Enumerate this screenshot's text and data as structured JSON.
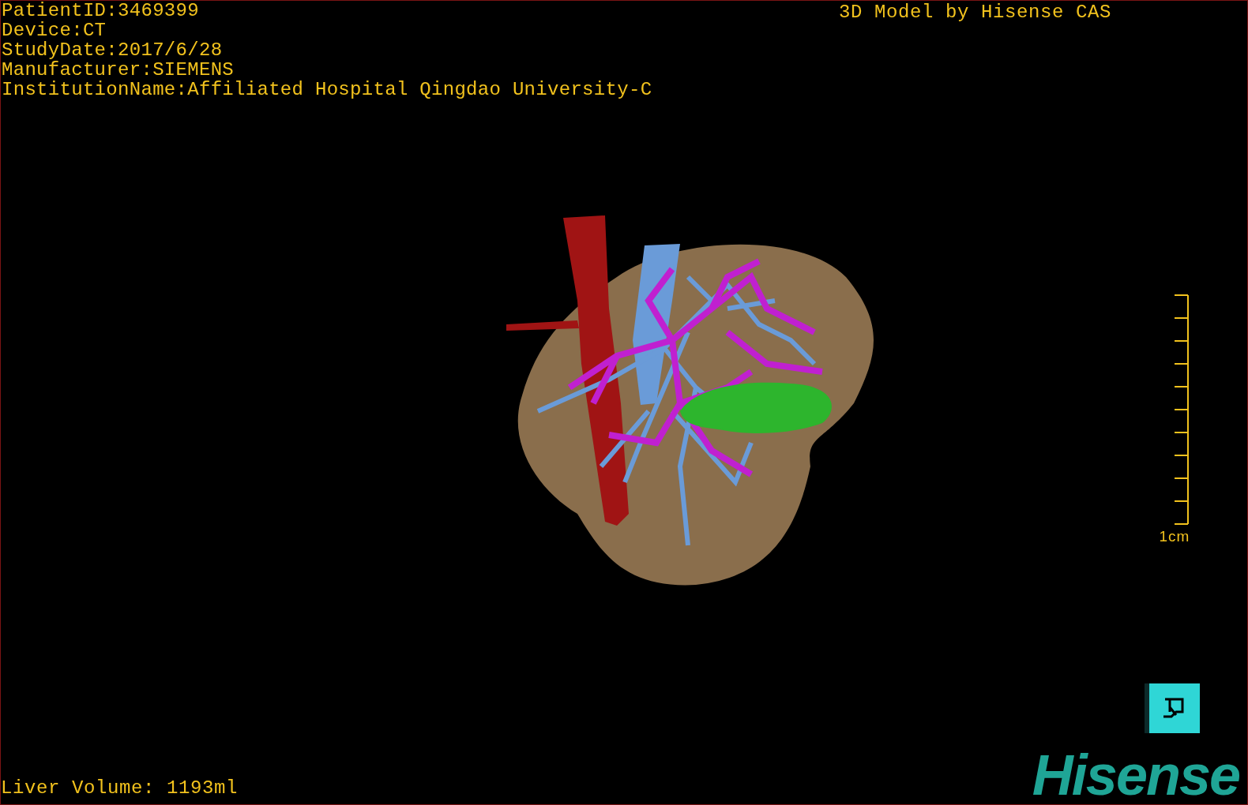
{
  "viewer": {
    "title": "3D Model by Hisense CAS",
    "study_info": [
      "PatientID:3469399",
      "Device:CT",
      "StudyDate:2017/6/28",
      "Manufacturer:SIEMENS",
      "InstitutionName:Affiliated Hospital Qingdao University-C"
    ],
    "scale_bar": {
      "label": "1cm"
    },
    "liver_volume": "Liver Volume: 1193ml",
    "logo": "Hisense"
  }
}
